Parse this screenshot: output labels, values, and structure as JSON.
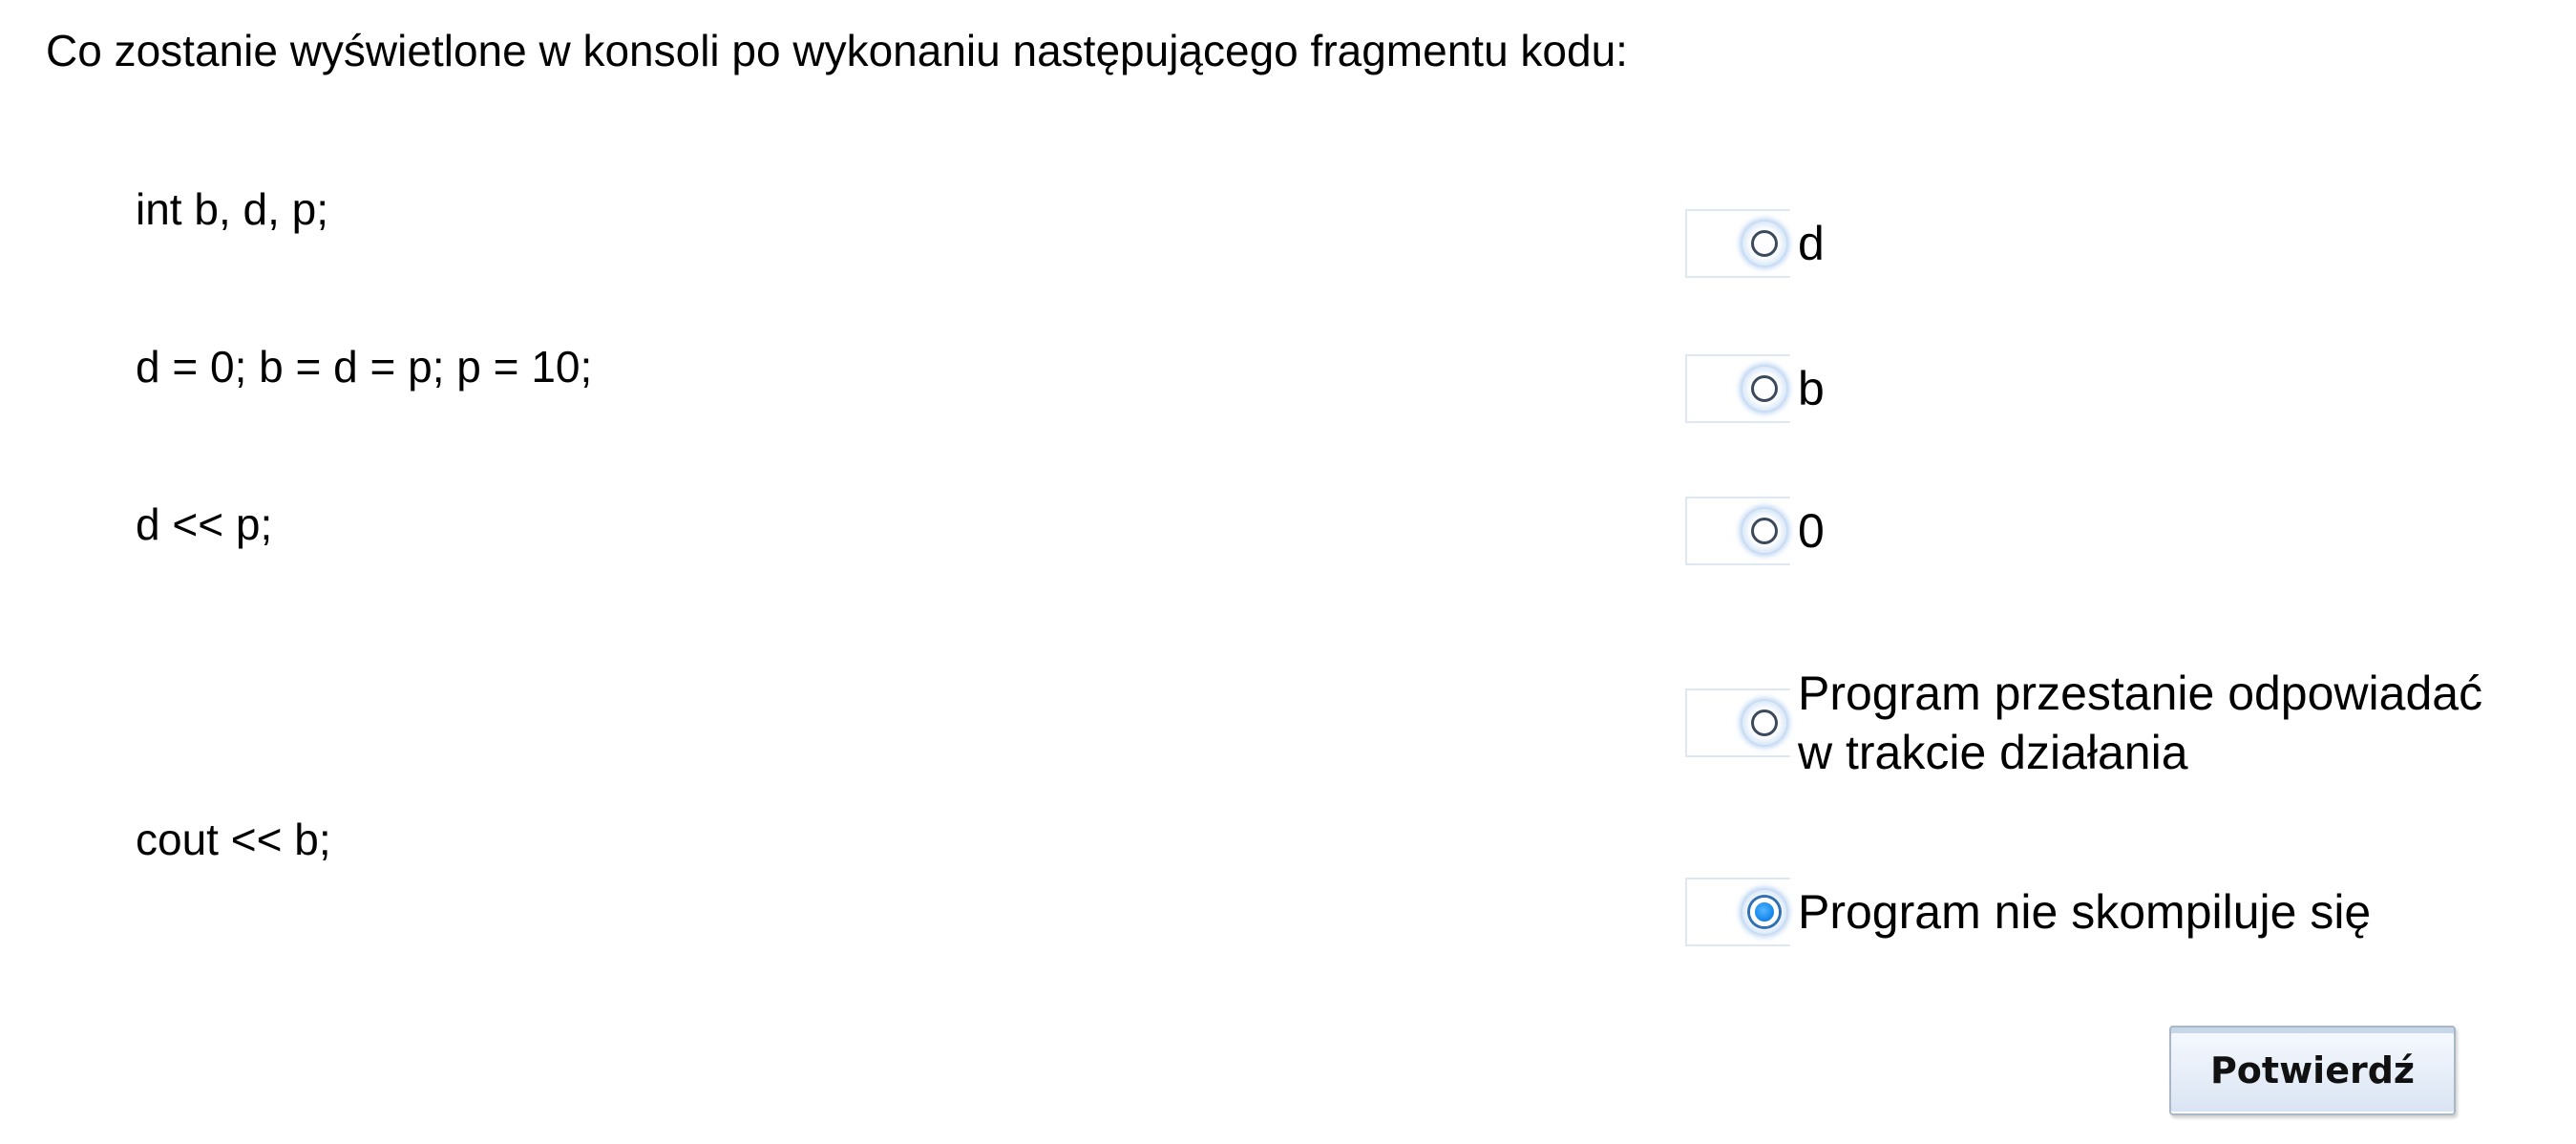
{
  "question": {
    "text": "Co zostanie wyświetlone w konsoli po wykonaniu następującego fragmentu kodu:",
    "code_lines": [
      "int b, d, p;",
      "d = 0; b = d = p; p = 10;",
      "d << p;",
      "",
      "cout << b;"
    ]
  },
  "options": [
    {
      "lines": [
        "d"
      ],
      "checked": false
    },
    {
      "lines": [
        "b"
      ],
      "checked": false
    },
    {
      "lines": [
        "0"
      ],
      "checked": false
    },
    {
      "lines": [
        "Program przestanie odpowiadać",
        "w trakcie działania"
      ],
      "checked": false
    },
    {
      "lines": [
        "Program nie skompiluje się"
      ],
      "checked": true
    }
  ],
  "submit": {
    "label": "Potwierdź"
  }
}
